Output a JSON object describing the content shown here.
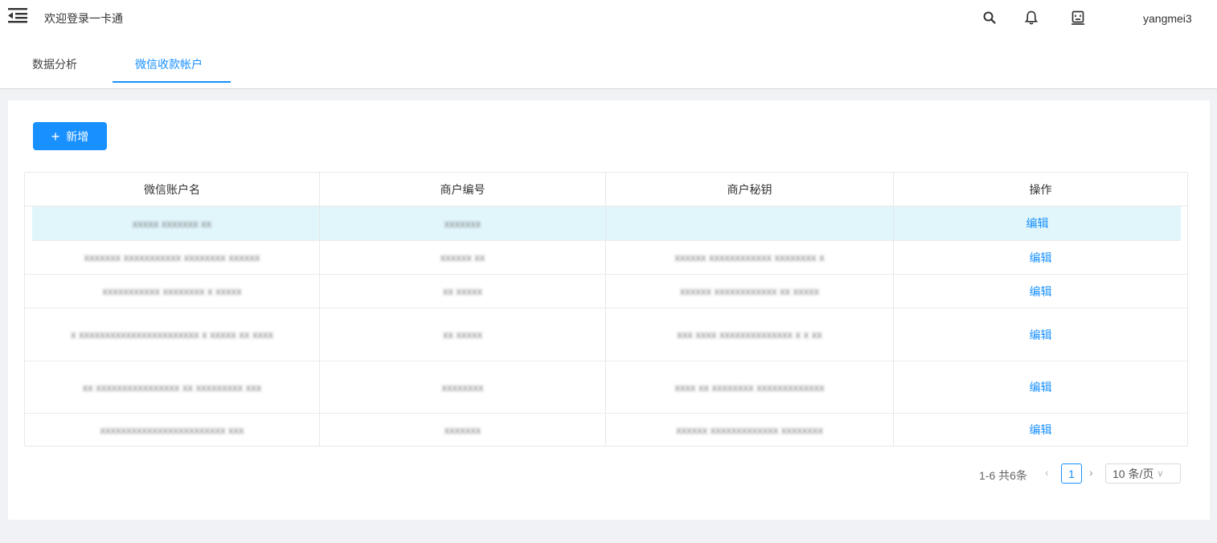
{
  "header": {
    "title": "欢迎登录一卡通",
    "username": "yangmei3",
    "icons": [
      "menu-fold-icon",
      "search-icon",
      "bell-icon",
      "robot-icon"
    ]
  },
  "tabs": [
    {
      "label": "数据分析",
      "active": false
    },
    {
      "label": "微信收款帐户",
      "active": true
    }
  ],
  "toolbar": {
    "add_label": "新增"
  },
  "table": {
    "columns": [
      "微信账户名",
      "商户编号",
      "商户秘钥",
      "操作"
    ],
    "rows": [
      {
        "name": "xxxxx xxxxxxx xx",
        "merchant_id": "xxxxxxx",
        "secret": "",
        "action": "编辑"
      },
      {
        "name": "xxxxxxx xxxxxxxxxxx xxxxxxxx xxxxxx",
        "merchant_id": "xxxxxx xx",
        "secret": "xxxxxx xxxxxxxxxxxx xxxxxxxx x",
        "action": "编辑"
      },
      {
        "name": "xxxxxxxxxxx xxxxxxxx x xxxxx",
        "merchant_id": "xx xxxxx",
        "secret": "xxxxxx xxxxxxxxxxxx xx xxxxx",
        "action": "编辑"
      },
      {
        "name": "x xxxxxxxxxxxxxxxxxxxxxxx x xxxxx xx xxxx",
        "merchant_id": "xx xxxxx",
        "secret": "xxx xxxx xxxxxxxxxxxxxx x x xx",
        "action": "编辑"
      },
      {
        "name": "xx xxxxxxxxxxxxxxxx xx xxxxxxxxx xxx",
        "merchant_id": "xxxxxxxx",
        "secret": "xxxx xx xxxxxxxx xxxxxxxxxxxxx",
        "action": "编辑"
      },
      {
        "name": "xxxxxxxxxxxxxxxxxxxxxxxx xxx",
        "merchant_id": "xxxxxxx",
        "secret": "xxxxxx xxxxxxxxxxxxx xxxxxxxx",
        "action": "编辑"
      }
    ]
  },
  "pagination": {
    "total_text": "1-6 共6条",
    "current_page": "1",
    "page_size": "10 条/页"
  },
  "colors": {
    "accent": "#1890ff",
    "selected_row": "#e0f6fb"
  }
}
